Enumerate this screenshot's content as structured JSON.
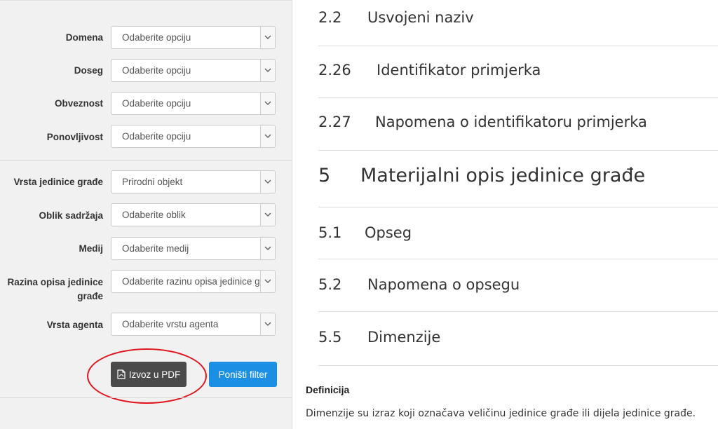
{
  "filters": [
    {
      "label": "Domena",
      "value": "Odaberite opciju"
    },
    {
      "label": "Doseg",
      "value": "Odaberite opciju"
    },
    {
      "label": "Obveznost",
      "value": "Odaberite opciju"
    },
    {
      "label": "Ponovljivost",
      "value": "Odaberite opciju"
    },
    {
      "label": "Vrsta jedinice građe",
      "value": "Prirodni objekt"
    },
    {
      "label": "Oblik sadržaja",
      "value": "Odaberite oblik"
    },
    {
      "label": "Medij",
      "value": "Odaberite medij"
    },
    {
      "label_line1": "Razina opisa jedinice",
      "label_line2": "građe",
      "value": "Odaberite razinu opisa jedinice građe"
    },
    {
      "label": "Vrsta agenta",
      "value": "Odaberite vrstu agenta"
    }
  ],
  "buttons": {
    "pdf_label": "Izvoz u PDF",
    "reset_label": "Poništi filter"
  },
  "sections": [
    {
      "num": "2.2",
      "title": "Usvojeni naziv"
    },
    {
      "num": "2.26",
      "title": "Identifikator primjerka"
    },
    {
      "num": "2.27",
      "title": "Napomena o identifikatoru primjerka"
    },
    {
      "num": "5",
      "title": "Materijalni opis jedinice građe"
    },
    {
      "num": "5.1",
      "title": "Opseg"
    },
    {
      "num": "5.2",
      "title": "Napomena o opsegu"
    },
    {
      "num": "5.5",
      "title": "Dimenzije"
    }
  ],
  "definition": {
    "heading": "Definicija",
    "text": "Dimenzije su izraz koji označava veličinu jedinice građe ili dijela jedinice građe."
  },
  "colors": {
    "reset_button": "#1a8fe3",
    "pdf_button": "#4a4a4a",
    "annotation": "#e0141c"
  }
}
